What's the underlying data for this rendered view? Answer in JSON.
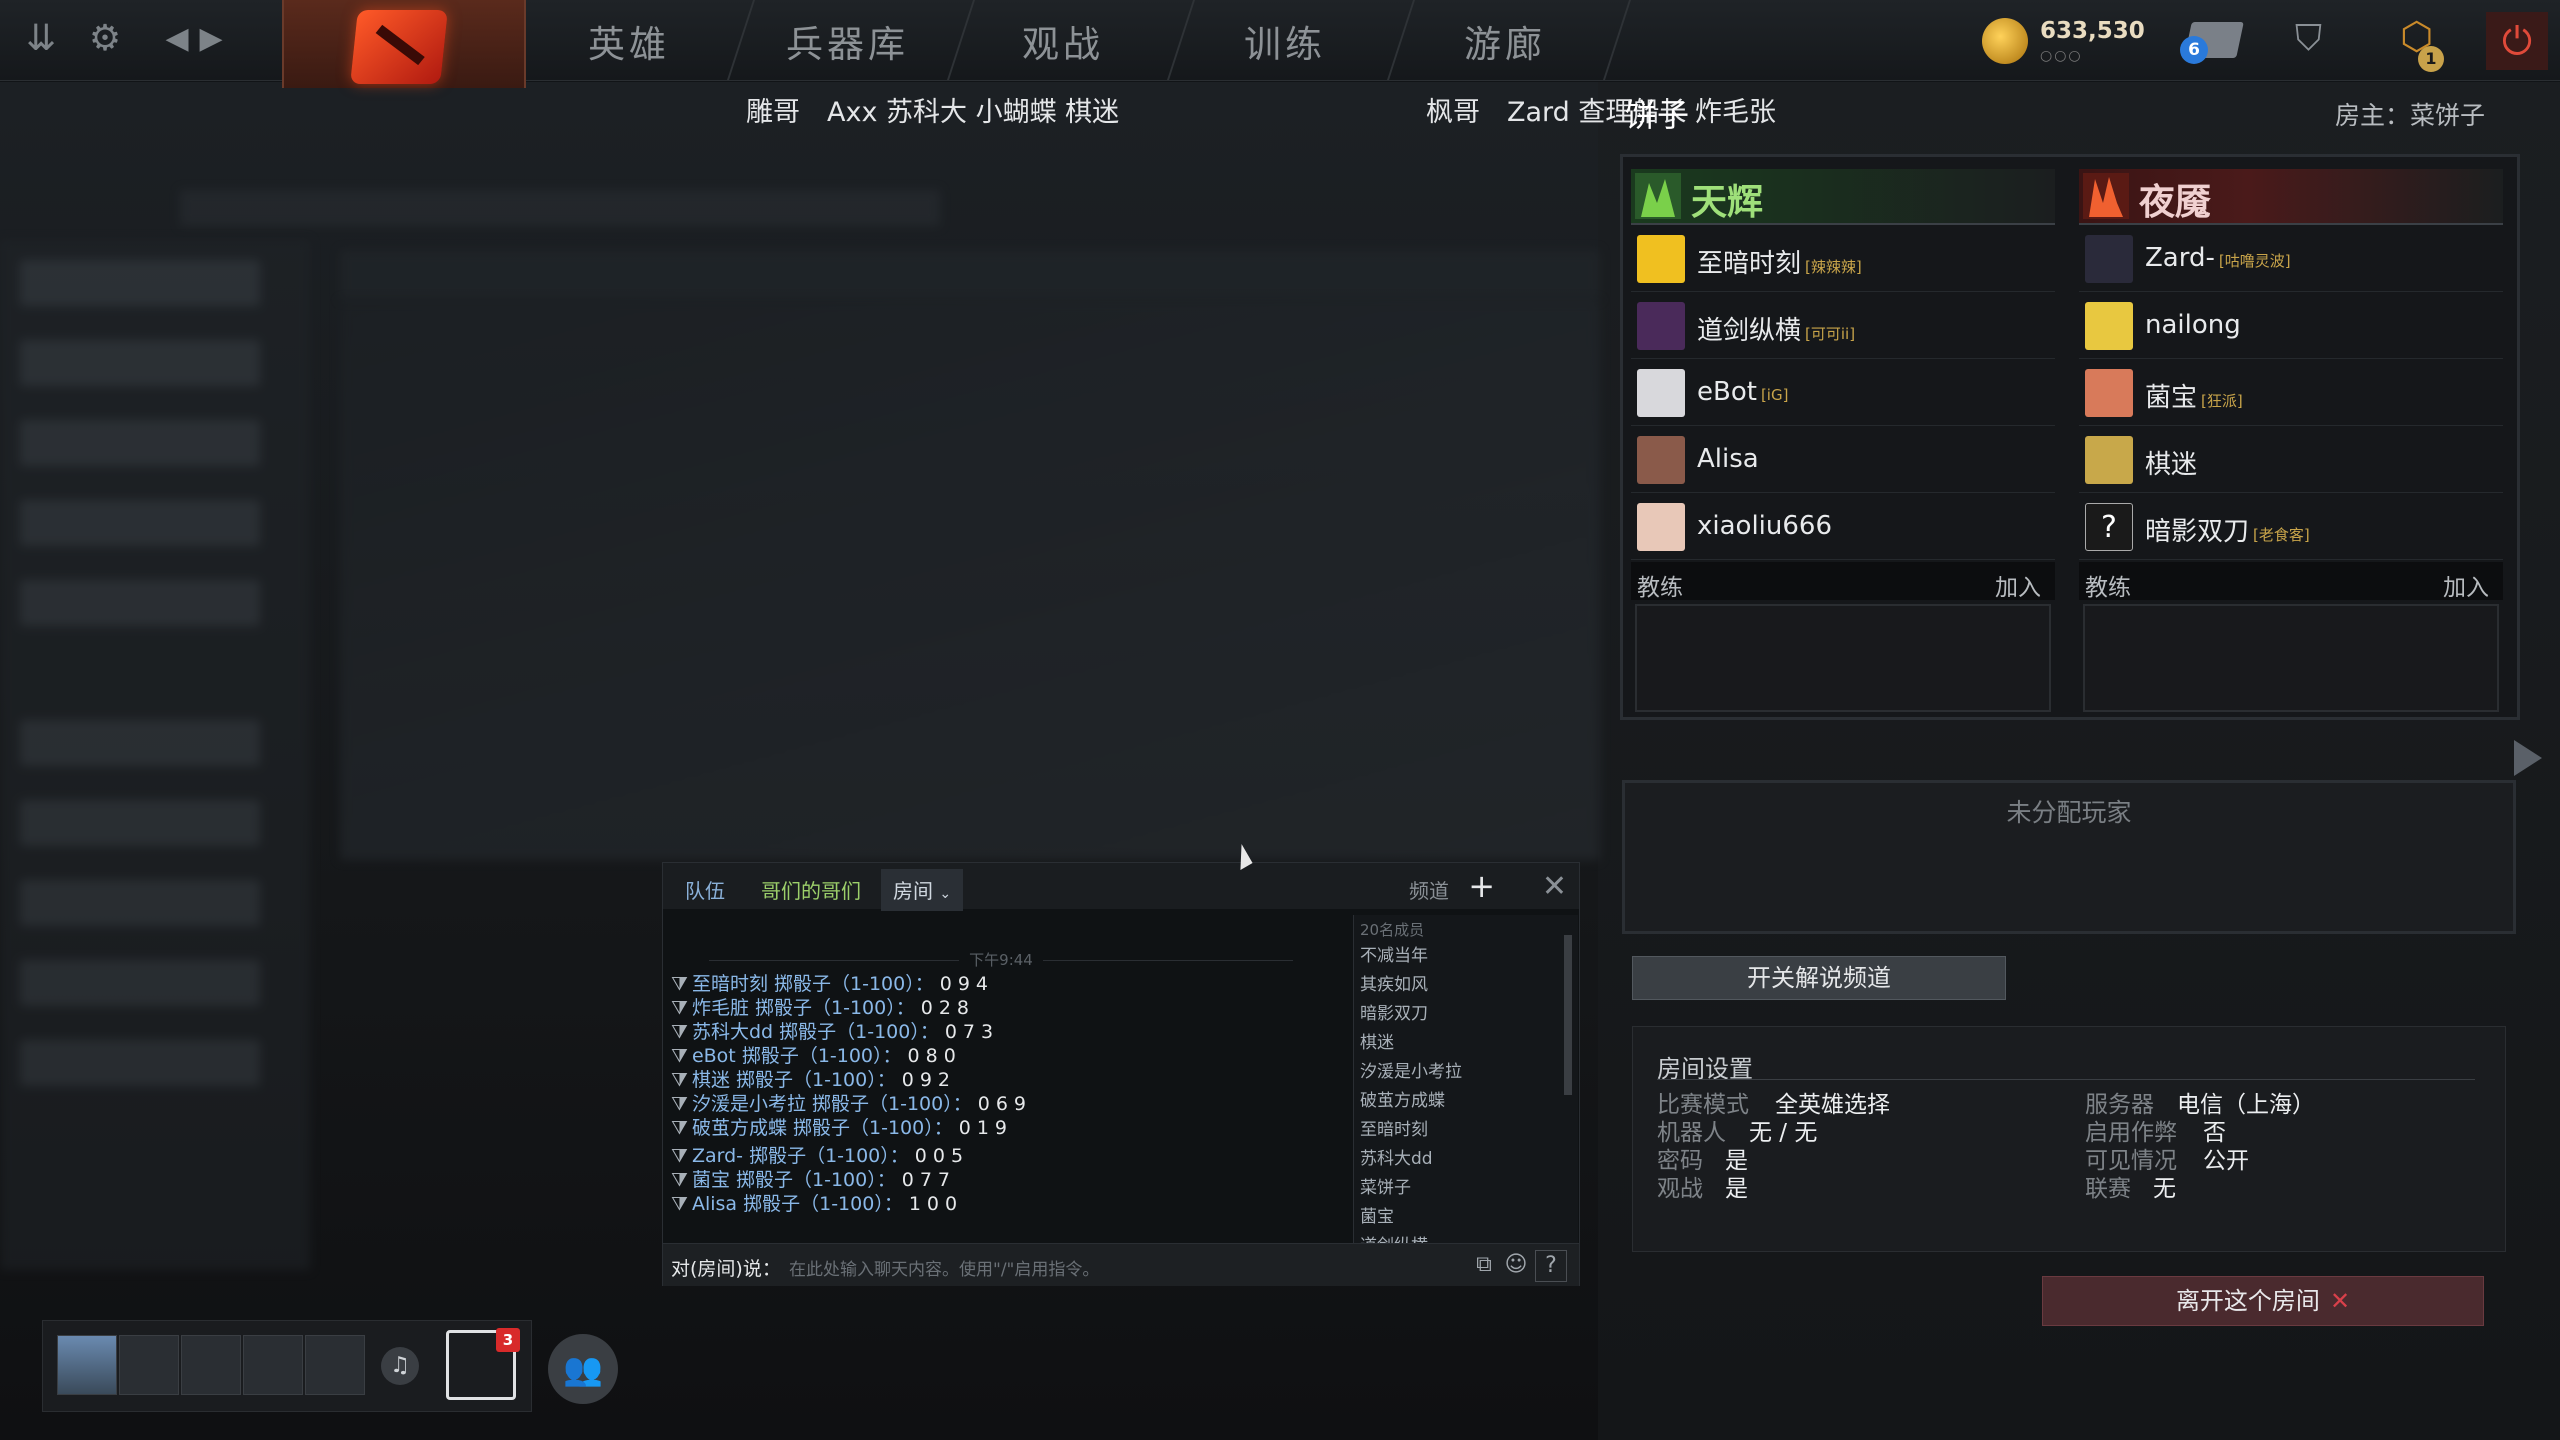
{
  "nav": {
    "items": [
      "英雄",
      "兵器库",
      "观战",
      "训练",
      "游廊"
    ]
  },
  "topbar": {
    "gold": "633,530",
    "gold_dots": "○○○",
    "mail_count": "6",
    "quest_count": "1"
  },
  "header": {
    "names_left": "雕哥　Axx  苏科大 小蝴蝶  棋迷",
    "names_right": "枫哥　Zard  查理船长 炸毛张",
    "lobby_title": "饼子",
    "host": "房主：菜饼子"
  },
  "radiant": {
    "name": "天辉",
    "players": [
      {
        "name": "至暗时刻",
        "tag": "[辣辣辣]",
        "color": "#f0c020"
      },
      {
        "name": "道剑纵横",
        "tag": "[可可ii]",
        "color": "#4a2a5a"
      },
      {
        "name": "eBot",
        "tag": "[iG]",
        "color": "#d8d8dc"
      },
      {
        "name": "Alisa",
        "tag": "",
        "color": "#8a5a4a"
      },
      {
        "name": "xiaoliu666",
        "tag": "",
        "color": "#e8c8b8"
      }
    ],
    "coach_label": "教练",
    "join_label": "加入"
  },
  "dire": {
    "name": "夜魇",
    "players": [
      {
        "name": "Zard-",
        "tag": "[咕噜灵波]",
        "color": "#2a2a3a"
      },
      {
        "name": "nailong",
        "tag": "",
        "color": "#e8c840"
      },
      {
        "name": "菌宝",
        "tag": "[狂派]",
        "color": "#d87a5a"
      },
      {
        "name": "棋迷",
        "tag": "",
        "color": "#c8a84a"
      },
      {
        "name": "暗影双刀",
        "tag": "[老食客]",
        "color": "#1a1a1a"
      }
    ],
    "coach_label": "教练",
    "join_label": "加入"
  },
  "unassigned_label": "未分配玩家",
  "caster_button": "开关解说频道",
  "settings": {
    "title": "房间设置",
    "left": [
      {
        "k": "比赛模式",
        "v": "全英雄选择"
      },
      {
        "k": "机器人",
        "v": "无 / 无"
      },
      {
        "k": "密码",
        "v": "是"
      },
      {
        "k": "观战",
        "v": "是"
      }
    ],
    "right": [
      {
        "k": "服务器",
        "v": "电信（上海）"
      },
      {
        "k": "启用作弊",
        "v": "否"
      },
      {
        "k": "可见情况",
        "v": "公开"
      },
      {
        "k": "联赛",
        "v": "无"
      }
    ]
  },
  "leave_button": "离开这个房间",
  "chat": {
    "tabs": [
      "队伍",
      "哥们的哥们",
      "房间"
    ],
    "channel_label": "频道",
    "time": "下午9:44",
    "messages": [
      {
        "who": "至暗时刻",
        "text": "掷骰子（1-100）：",
        "roll": "094"
      },
      {
        "who": "炸毛脏",
        "text": "掷骰子（1-100）：",
        "roll": "028"
      },
      {
        "who": "苏科大dd",
        "text": "掷骰子（1-100）：",
        "roll": "073"
      },
      {
        "who": "eBot",
        "text": "掷骰子（1-100）：",
        "roll": "080"
      },
      {
        "who": "棋迷",
        "text": "掷骰子（1-100）：",
        "roll": "092"
      },
      {
        "who": "汐湲是小考拉",
        "text": "掷骰子（1-100）：",
        "roll": "069"
      },
      {
        "who": "破茧方成蝶",
        "text": "掷骰子（1-100）：",
        "roll": "019"
      },
      {
        "who": "Zard-",
        "text": "掷骰子（1-100）：",
        "roll": "005"
      },
      {
        "who": "菌宝",
        "text": "掷骰子（1-100）：",
        "roll": "077"
      },
      {
        "who": "Alisa",
        "text": "掷骰子（1-100）：",
        "roll": "100"
      }
    ],
    "member_count": "20名成员",
    "members": [
      "不减当年",
      "其疾如风",
      "暗影双刀",
      "棋迷",
      "汐湲是小考拉",
      "破茧方成蝶",
      "至暗时刻",
      "苏科大dd",
      "菜饼子",
      "菌宝",
      "道剑纵横"
    ],
    "input_label": "对(房间)说：",
    "input_placeholder": "在此处输入聊天内容。使用\"/\"启用指令。"
  },
  "party": {
    "notification_count": "3"
  }
}
